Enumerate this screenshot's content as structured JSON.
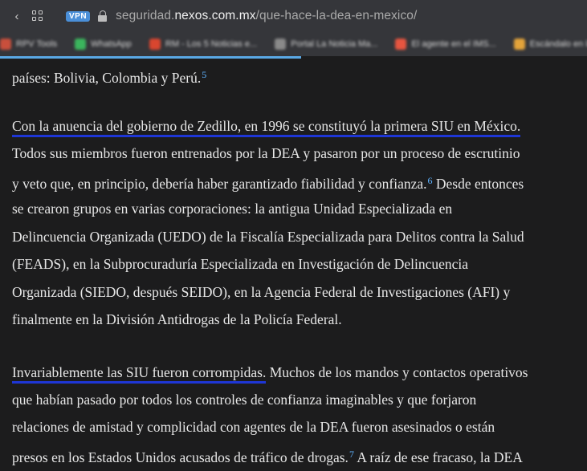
{
  "browser": {
    "vpn_label": "VPN",
    "url_prefix": "seguridad.",
    "url_domain": "nexos.com.mx",
    "url_path": "/que-hace-la-dea-en-mexico/"
  },
  "bookmarks": [
    {
      "label": "RPV Tools",
      "color": "#c94f3c"
    },
    {
      "label": "WhatsApp",
      "color": "#3bb55d"
    },
    {
      "label": "RM - Los 5 Noticias e...",
      "color": "#d9462f"
    },
    {
      "label": "Portal La Noticia Ma...",
      "color": "#8a8a8a"
    },
    {
      "label": "El agente en el IMS...",
      "color": "#e65540"
    },
    {
      "label": "Escándalo en las asame...",
      "color": "#e3a33a"
    }
  ],
  "article": {
    "l1_text": "países: Bolivia, Colombia y Perú.",
    "l1_fn": "5",
    "l2_ul": "Con la anuencia del gobierno de Zedillo, en 1996 se constituyó la primera SIU en México.",
    "l3": "Todos sus miembros fueron entrenados por la DEA y pasaron por un proceso de escrutinio",
    "l4_a": "y veto que, en principio, debería haber garantizado fiabilidad y confianza.",
    "l4_fn": "6",
    "l4_b": " Desde entonces",
    "l5": "se crearon grupos en varias corporaciones: la antigua Unidad Especializada en",
    "l6": "Delincuencia Organizada (UEDO) de la Fiscalía Especializada para Delitos contra la Salud",
    "l7": "(FEADS), en la Subprocuraduría Especializada en Investigación de Delincuencia",
    "l8": "Organizada (SIEDO, después SEIDO), en la Agencia Federal de Investigaciones (AFI) y",
    "l9": "finalmente en la División Antidrogas de la Policía Federal.",
    "l10_ul": "Invariablemente las SIU fueron corrompidas.",
    "l10_rest": " Muchos de los mandos y contactos operativos",
    "l11": "que habían pasado por todos los controles de confianza imaginables y que forjaron",
    "l12": "relaciones de amistad y complicidad con agentes de la DEA fueron asesinados o están",
    "l13_a": "presos en los Estados Unidos acusados de tráfico de drogas.",
    "l13_fn": "7",
    "l13_b": " A raíz de ese fracaso, la DEA"
  }
}
